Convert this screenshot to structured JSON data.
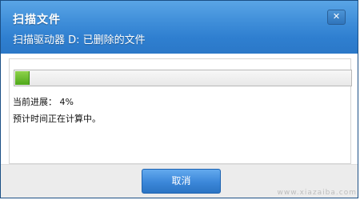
{
  "dialog": {
    "title": "扫描文件",
    "subtitle": "扫描驱动器 D: 已删除的文件",
    "close_symbol": "✕"
  },
  "progress": {
    "value_percent": 4,
    "label": "当前进展： 4%",
    "eta_text": "预计时间正在计算中。"
  },
  "footer": {
    "cancel_label": "取消"
  },
  "watermark": "www.xiazaiba.com",
  "colors": {
    "titlebar": "#2f7fd0",
    "progress_fill": "#62b82a",
    "button": "#3b87d9"
  }
}
